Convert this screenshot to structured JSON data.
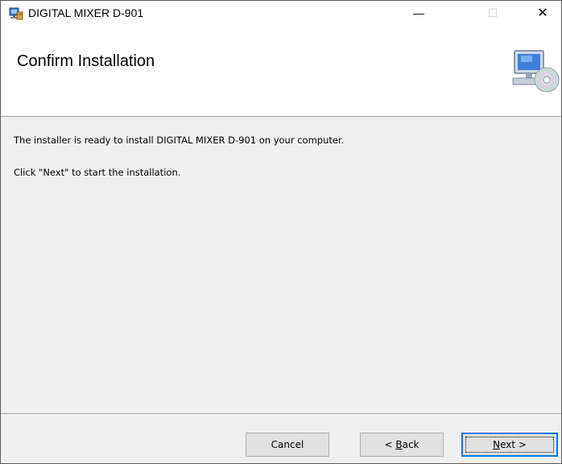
{
  "window": {
    "title": "DIGITAL MIXER D-901",
    "controls": {
      "minimize": "—",
      "maximize": "☐",
      "close": "✕"
    }
  },
  "header": {
    "title": "Confirm Installation",
    "art_icon": "computer-cd-icon"
  },
  "body": {
    "line1": "The installer is ready to install DIGITAL MIXER D-901 on your computer.",
    "line2": "Click \"Next\" to start the installation."
  },
  "buttons": {
    "cancel": {
      "label": "Cancel"
    },
    "back": {
      "prefix": "< ",
      "mnemonic": "B",
      "rest": "ack"
    },
    "next": {
      "mnemonic": "N",
      "rest": "ext >"
    }
  },
  "colors": {
    "focus_border": "#0078d7",
    "button_face": "#e1e1e1",
    "dialog_bg": "#f0f0f0"
  }
}
